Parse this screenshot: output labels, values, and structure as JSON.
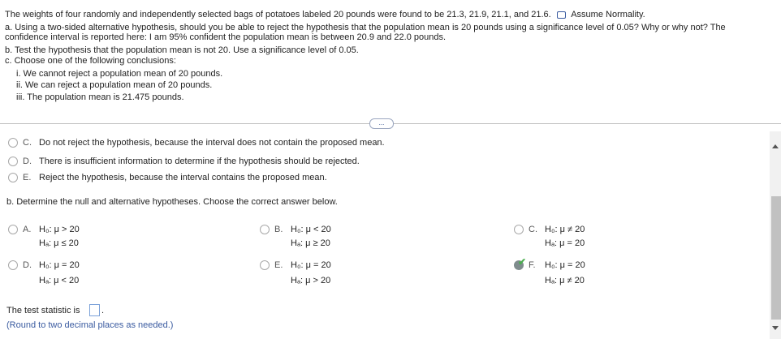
{
  "question": {
    "intro": "The weights of four randomly and independently selected bags of potatoes labeled 20 pounds were found to be 21.3, 21.9, 21.1, and 21.6.",
    "assume": "Assume Normality.",
    "part_a_line1": "a. Using a two-sided alternative hypothesis, should you be able to reject the hypothesis that the population mean is 20 pounds using a significance level of 0.05? Why or why not? The",
    "part_a_line2": "confidence interval is reported here: I am 95% confident the population mean is between 20.9 and 22.0 pounds.",
    "part_b": "b. Test the hypothesis that the population mean is not 20. Use a significance level of 0.05.",
    "part_c": "c. Choose one of the following conclusions:",
    "conclusions": [
      "i. We cannot reject a population mean of 20 pounds.",
      "ii. We can reject a population mean of 20 pounds.",
      "iii. The population mean is 21.475 pounds."
    ]
  },
  "expand_label": "...",
  "part_a_options": [
    {
      "letter": "C.",
      "text": "Do not reject the hypothesis, because the interval does not contain the proposed mean."
    },
    {
      "letter": "D.",
      "text": "There is insufficient information to determine if the hypothesis should be rejected."
    },
    {
      "letter": "E.",
      "text": "Reject the hypothesis, because the interval contains the proposed mean."
    }
  ],
  "part_b_prompt": "b. Determine the null and alternative hypotheses. Choose the correct answer below.",
  "hypothesis_options": [
    {
      "letter": "A.",
      "h0": "H₀: μ > 20",
      "ha": "Hₐ: μ ≤ 20",
      "selected": false
    },
    {
      "letter": "B.",
      "h0": "H₀: μ < 20",
      "ha": "Hₐ: μ ≥ 20",
      "selected": false
    },
    {
      "letter": "C.",
      "h0": "H₀: μ ≠ 20",
      "ha": "Hₐ: μ = 20",
      "selected": false
    },
    {
      "letter": "D.",
      "h0": "H₀: μ = 20",
      "ha": "Hₐ: μ < 20",
      "selected": false
    },
    {
      "letter": "E.",
      "h0": "H₀: μ = 20",
      "ha": "Hₐ: μ > 20",
      "selected": false
    },
    {
      "letter": "F.",
      "h0": "H₀: μ = 20",
      "ha": "Hₐ: μ ≠ 20",
      "selected": true
    }
  ],
  "test_statistic_label": "The test statistic is",
  "test_statistic_value": "",
  "test_statistic_suffix": ".",
  "round_instruction": "(Round to two decimal places as needed.)",
  "colors": {
    "accent": "#3a5ba0",
    "correct": "#4caf50"
  }
}
